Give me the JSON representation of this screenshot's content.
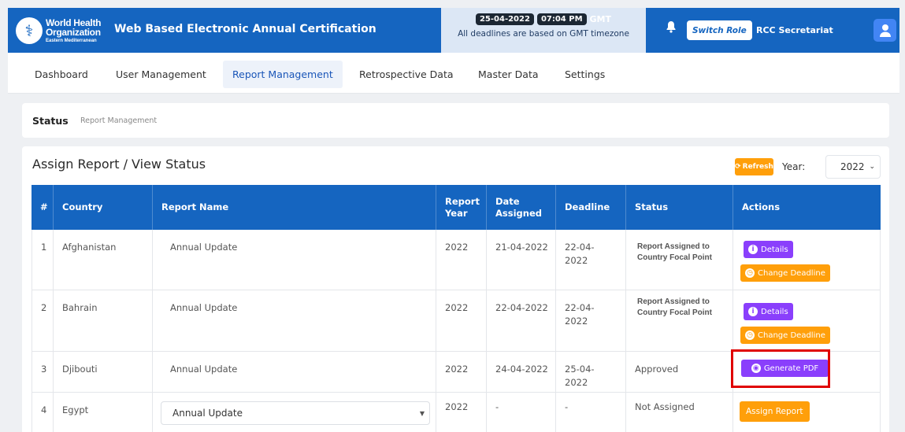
{
  "header": {
    "org_line1": "World Health",
    "org_line2": "Organization",
    "org_line3": "Eastern Mediterranean",
    "app_title": "Web Based Electronic Annual Certification",
    "date": "25-04-2022",
    "time": "07:04 PM",
    "timezone": "GMT",
    "deadline_note": "All deadlines are based on GMT timezone",
    "switch_role": "Switch Role",
    "role_name": "RCC Secretariat"
  },
  "nav": {
    "items": [
      {
        "label": "Dashboard"
      },
      {
        "label": "User Management"
      },
      {
        "label": "Report Management"
      },
      {
        "label": "Retrospective Data"
      },
      {
        "label": "Master Data"
      },
      {
        "label": "Settings"
      }
    ],
    "active": "Report Management"
  },
  "breadcrumb": {
    "title": "Status",
    "sub": "Report Management"
  },
  "card": {
    "title": "Assign Report / View Status",
    "refresh_label": "Refresh",
    "year_label": "Year:",
    "year_value": "2022"
  },
  "table": {
    "headers": [
      "#",
      "Country",
      "Report Name",
      "Report Year",
      "Date Assigned",
      "Deadline",
      "Status",
      "Actions"
    ],
    "rows": [
      {
        "num": "1",
        "country": "Afghanistan",
        "report": "Annual Update",
        "year": "2022",
        "assigned": "21-04-2022",
        "deadline": "22-04-2022",
        "status": "Report Assigned to Country Focal Point"
      },
      {
        "num": "2",
        "country": "Bahrain",
        "report": "Annual Update",
        "year": "2022",
        "assigned": "22-04-2022",
        "deadline": "22-04-2022",
        "status": "Report Assigned to Country Focal Point"
      },
      {
        "num": "3",
        "country": "Djibouti",
        "report": "Annual Update",
        "year": "2022",
        "assigned": "24-04-2022",
        "deadline": "25-04-2022",
        "status": "Approved"
      },
      {
        "num": "4",
        "country": "Egypt",
        "report": "Annual Update",
        "year": "2022",
        "assigned": "-",
        "deadline": "-",
        "status": "Not Assigned"
      }
    ],
    "actions": {
      "details": "Details",
      "change_deadline": "Change Deadline",
      "generate_pdf": "Generate PDF",
      "assign_report": "Assign Report"
    }
  },
  "colors": {
    "primary": "#1565c0",
    "purple": "#8a3ffc",
    "orange": "#ff9f0a",
    "highlight": "#e00000"
  }
}
